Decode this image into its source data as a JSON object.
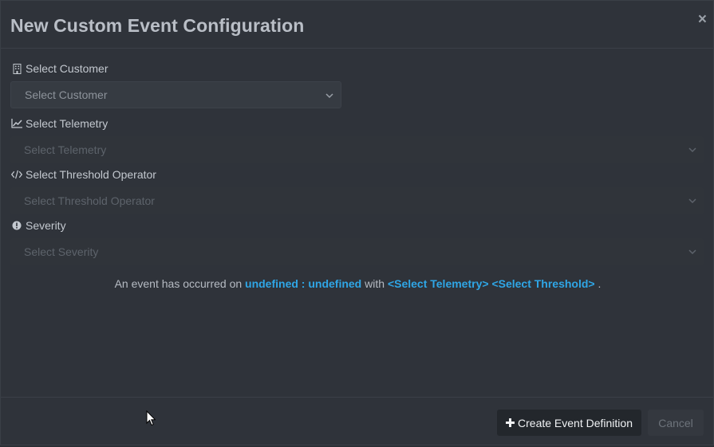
{
  "dialog": {
    "title": "New Custom Event Configuration",
    "close_label": "×"
  },
  "fields": {
    "customer": {
      "label": "Select Customer",
      "placeholder": "Select Customer",
      "icon": "building-icon"
    },
    "telemetry": {
      "label": "Select Telemetry",
      "placeholder": "Select Telemetry",
      "icon": "line-chart-icon"
    },
    "operator": {
      "label": "Select Threshold Operator",
      "placeholder": "Select Threshold Operator",
      "icon": "code-icon"
    },
    "severity": {
      "label": "Severity",
      "placeholder": "Select Severity",
      "icon": "exclamation-circle-icon"
    }
  },
  "summary": {
    "prefix": "An event has occurred on",
    "target": "undefined : undefined",
    "middle": "with",
    "telemetry": "<Select Telemetry>",
    "threshold": "<Select Threshold>",
    "suffix": "."
  },
  "footer": {
    "create_label": "Create Event Definition",
    "cancel_label": "Cancel"
  },
  "colors": {
    "accent": "#2fa6e6",
    "background": "#2f333a"
  }
}
